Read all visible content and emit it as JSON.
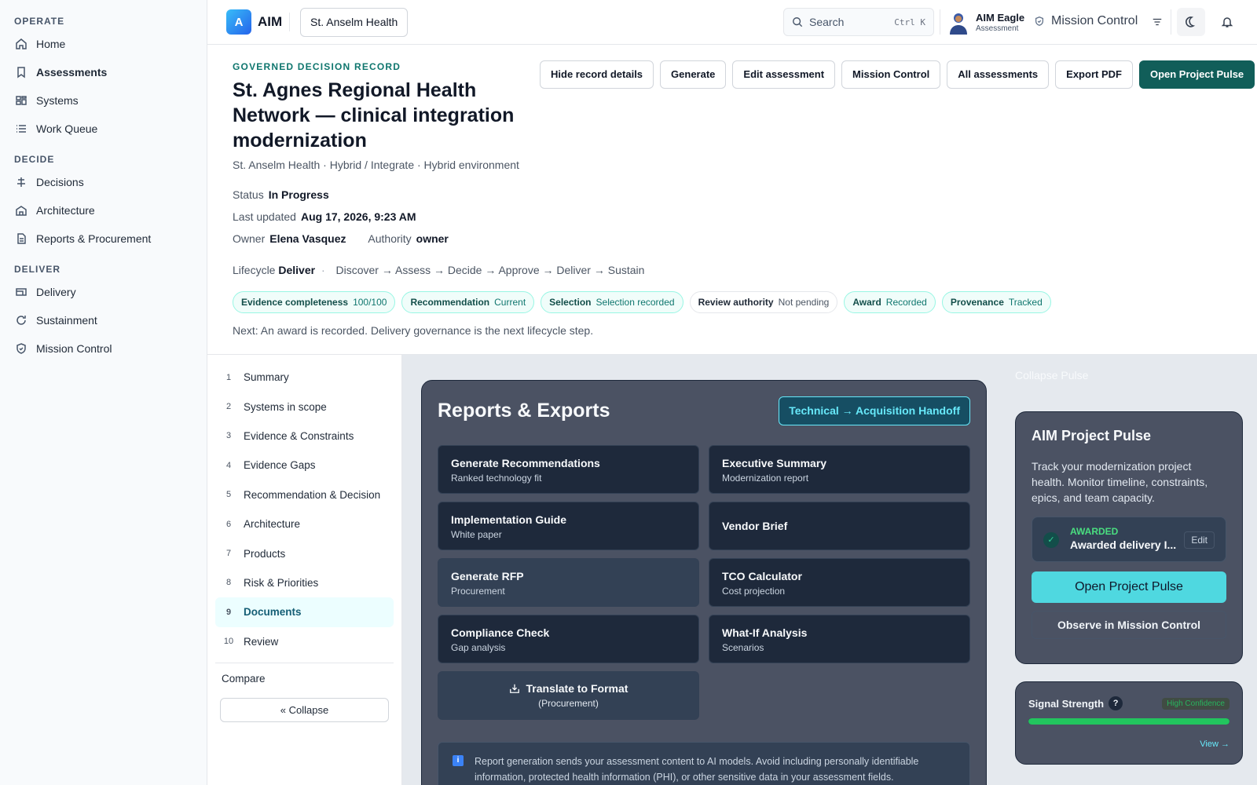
{
  "sidebar": {
    "sections": [
      {
        "label": "OPERATE",
        "items": [
          {
            "label": "Home",
            "icon": "home-icon"
          },
          {
            "label": "Assessments",
            "icon": "bookmark-icon",
            "active": true
          },
          {
            "label": "Systems",
            "icon": "grid-icon"
          },
          {
            "label": "Work Queue",
            "icon": "list-icon"
          }
        ]
      },
      {
        "label": "DECIDE",
        "items": [
          {
            "label": "Decisions",
            "icon": "scale-icon"
          },
          {
            "label": "Architecture",
            "icon": "building-icon"
          },
          {
            "label": "Reports & Procurement",
            "icon": "document-icon"
          }
        ]
      },
      {
        "label": "DELIVER",
        "items": [
          {
            "label": "Delivery",
            "icon": "truck-icon"
          },
          {
            "label": "Sustainment",
            "icon": "refresh-icon"
          },
          {
            "label": "Mission Control",
            "icon": "shield-icon"
          }
        ]
      }
    ]
  },
  "topbar": {
    "logo_letter": "A",
    "app_name": "AIM",
    "org": "St. Anselm Health",
    "search_placeholder": "Search",
    "search_shortcut": "Ctrl K",
    "user_name": "AIM Eagle",
    "user_role": "Assessment",
    "mission_control": "Mission Control"
  },
  "record": {
    "eyebrow": "GOVERNED DECISION RECORD",
    "title": "St. Agnes Regional Health Network — clinical integration modernization",
    "subtitle": "St. Anselm Health · Hybrid / Integrate · Hybrid environment",
    "status_label": "Status",
    "status_value": "In Progress",
    "updated_label": "Last updated",
    "updated_value": "Aug 17, 2026, 9:23 AM",
    "owner_label": "Owner",
    "owner_value": "Elena Vasquez",
    "authority_label": "Authority",
    "authority_value": "owner",
    "lifecycle_label": "Lifecycle",
    "lifecycle_value": "Deliver",
    "lifecycle_steps": "Discover → Assess → Decide → Approve → Deliver → Sustain",
    "chips": [
      {
        "label": "Evidence completeness",
        "value": "100/100",
        "tone": "teal"
      },
      {
        "label": "Recommendation",
        "value": "Current",
        "tone": "teal"
      },
      {
        "label": "Selection",
        "value": "Selection recorded",
        "tone": "teal"
      },
      {
        "label": "Review authority",
        "value": "Not pending",
        "tone": "neutral"
      },
      {
        "label": "Award",
        "value": "Recorded",
        "tone": "teal"
      },
      {
        "label": "Provenance",
        "value": "Tracked",
        "tone": "teal"
      }
    ],
    "next_note": "Next: An award is recorded. Delivery governance is the next lifecycle step.",
    "actions": [
      "Hide record details",
      "Generate",
      "Edit assessment",
      "Mission Control",
      "All assessments",
      "Export PDF",
      "Open Project Pulse"
    ]
  },
  "steps": [
    {
      "num": "1",
      "label": "Summary"
    },
    {
      "num": "2",
      "label": "Systems in scope"
    },
    {
      "num": "3",
      "label": "Evidence & Constraints"
    },
    {
      "num": "4",
      "label": "Evidence Gaps"
    },
    {
      "num": "5",
      "label": "Recommendation & Decision"
    },
    {
      "num": "6",
      "label": "Architecture"
    },
    {
      "num": "7",
      "label": "Products"
    },
    {
      "num": "8",
      "label": "Risk & Priorities"
    },
    {
      "num": "9",
      "label": "Documents",
      "active": true
    },
    {
      "num": "10",
      "label": "Review"
    }
  ],
  "stepnav": {
    "compare": "Compare",
    "collapse": "« Collapse"
  },
  "reports": {
    "title": "Reports & Exports",
    "handoff": "Technical → Acquisition Handoff",
    "cards": [
      {
        "title": "Generate Recommendations",
        "sub": "Ranked technology fit"
      },
      {
        "title": "Executive Summary",
        "sub": "Modernization report"
      },
      {
        "title": "Implementation Guide",
        "sub": "White paper"
      },
      {
        "title": "Vendor Brief",
        "sub": ""
      },
      {
        "title": "Generate RFP",
        "sub": "Procurement"
      },
      {
        "title": "TCO Calculator",
        "sub": "Cost projection"
      },
      {
        "title": "Compliance Check",
        "sub": "Gap analysis"
      },
      {
        "title": "What-If Analysis",
        "sub": "Scenarios"
      }
    ],
    "translate_title": "Translate to Format",
    "translate_sub": "(Procurement)",
    "privacy": "Report generation sends your assessment content to AI models. Avoid including personally identifiable information, protected health information (PHI), or other sensitive data in your assessment fields. Organizations subject to HIPAA"
  },
  "pulse": {
    "collapse": "Collapse Pulse",
    "title": "AIM Project Pulse",
    "desc": "Track your modernization project health. Monitor timeline, constraints, epics, and team capacity.",
    "awarded_label": "AWARDED",
    "awarded_value": "Awarded delivery I...",
    "edit": "Edit",
    "open": "Open Project Pulse",
    "observe": "Observe in Mission Control"
  },
  "signal": {
    "label": "Signal Strength",
    "confidence": "High Confidence",
    "level": 1.0,
    "view": "View →"
  }
}
